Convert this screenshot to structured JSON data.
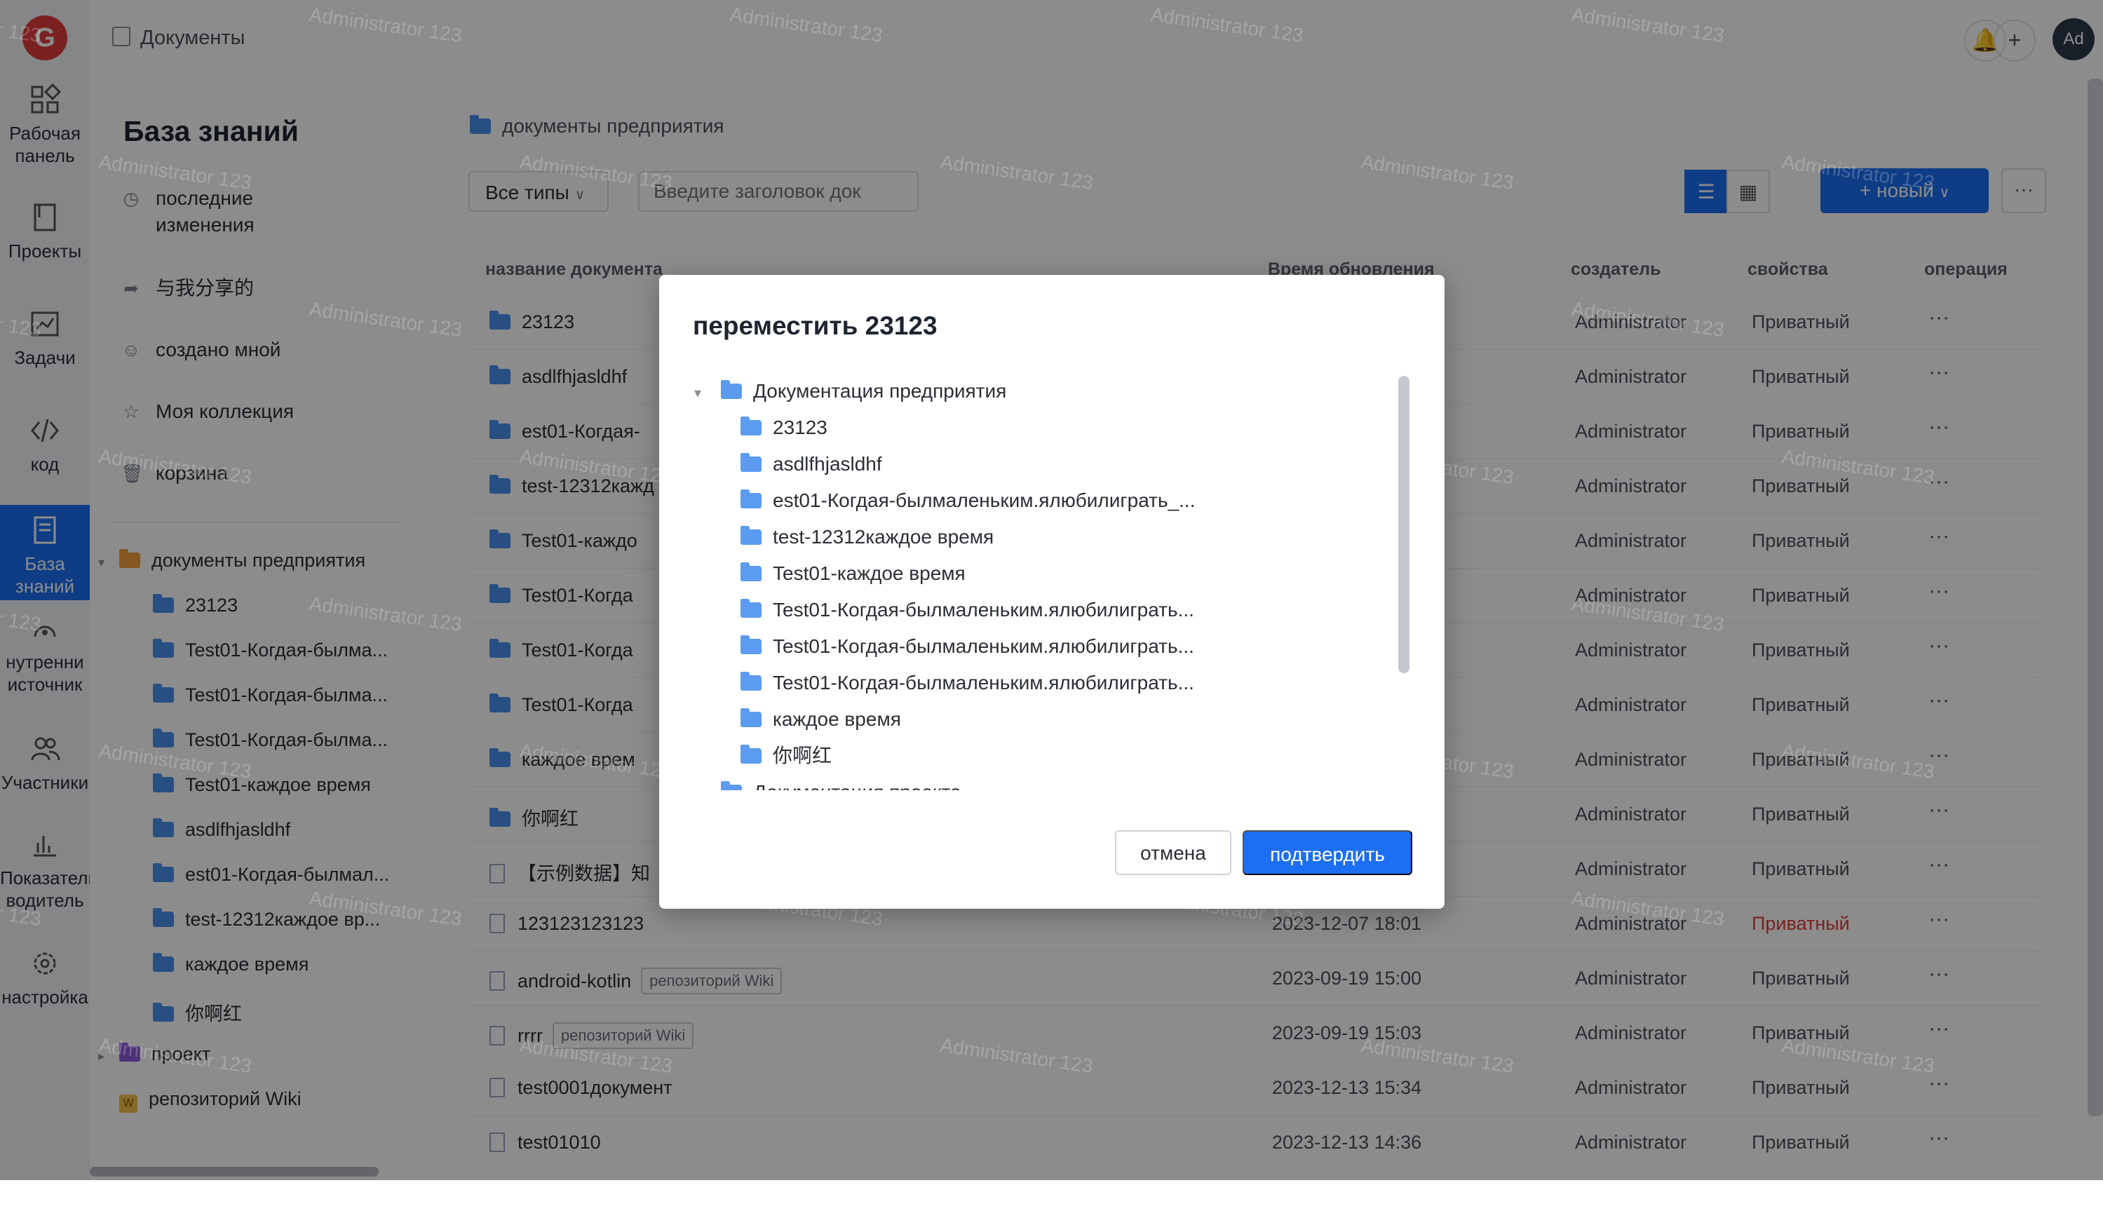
{
  "rail": {
    "logo": "G",
    "items": [
      {
        "label": "Рабочая панель",
        "icon": "dashboard-icon"
      },
      {
        "label": "Проекты",
        "icon": "book-icon"
      },
      {
        "label": "Задачи",
        "icon": "chart-board-icon"
      },
      {
        "label": "код",
        "icon": "code-icon"
      },
      {
        "label": "База знаний",
        "icon": "document-icon"
      },
      {
        "label": "нутренни источник",
        "icon": "source-icon"
      },
      {
        "label": "Участники",
        "icon": "users-icon"
      },
      {
        "label": "Показатели водитель",
        "icon": "stats-icon"
      },
      {
        "label": "настройка",
        "icon": "gear-icon"
      }
    ]
  },
  "topbar": {
    "breadcrumb": "Документы",
    "avatar": "Ad"
  },
  "kb": {
    "title": "База знаний",
    "nav": [
      {
        "label": "последние изменения",
        "icon": "clock-icon"
      },
      {
        "label": "与我分享的",
        "icon": "share-icon"
      },
      {
        "label": "создано мной",
        "icon": "person-icon"
      },
      {
        "label": "Моя коллекция",
        "icon": "star-icon"
      },
      {
        "label": "корзина",
        "icon": "trash-icon"
      }
    ],
    "tree": [
      {
        "label": "документы предприятия"
      },
      {
        "label": "23123"
      },
      {
        "label": "Test01-Когдая-былма..."
      },
      {
        "label": "Test01-Когдая-былма..."
      },
      {
        "label": "Test01-Когдая-былма..."
      },
      {
        "label": "Test01-каждое время"
      },
      {
        "label": "asdlfhjasldhf"
      },
      {
        "label": "est01-Когдая-былмал..."
      },
      {
        "label": "test-12312каждое вр..."
      },
      {
        "label": "каждое время"
      },
      {
        "label": "你啊红"
      },
      {
        "label": "проект"
      },
      {
        "label": "репозиторий Wiki"
      }
    ]
  },
  "main": {
    "path": "документы предприятия",
    "filter": "Все типы",
    "search_placeholder": "Введите заголовок док",
    "new_label": "+ новый",
    "columns": {
      "name": "название документа",
      "time": "Время обновления",
      "owner": "создатель",
      "prop": "свойства",
      "op": "операция"
    },
    "rows": [
      {
        "name": "23123",
        "type": "folder",
        "time": "",
        "owner": "Administrator",
        "prop": "Приватный"
      },
      {
        "name": "asdlfhjasldhf",
        "type": "folder",
        "time": "",
        "owner": "Administrator",
        "prop": "Приватный"
      },
      {
        "name": "est01-Когдая-",
        "type": "folder",
        "time": "",
        "owner": "Administrator",
        "prop": "Приватный"
      },
      {
        "name": "test-12312кажд",
        "type": "folder",
        "time": "",
        "owner": "Administrator",
        "prop": "Приватный"
      },
      {
        "name": "Test01-каждо",
        "type": "folder",
        "time": "",
        "owner": "Administrator",
        "prop": "Приватный"
      },
      {
        "name": "Test01-Когда",
        "type": "folder",
        "time": "",
        "owner": "Administrator",
        "prop": "Приватный"
      },
      {
        "name": "Test01-Когда",
        "type": "folder",
        "time": "",
        "owner": "Administrator",
        "prop": "Приватный"
      },
      {
        "name": "Test01-Когда",
        "type": "folder",
        "time": "",
        "owner": "Administrator",
        "prop": "Приватный"
      },
      {
        "name": "каждое врем",
        "type": "folder",
        "time": "",
        "owner": "Administrator",
        "prop": "Приватный"
      },
      {
        "name": "你啊红",
        "type": "folder",
        "time": "",
        "owner": "Administrator",
        "prop": "Приватный"
      },
      {
        "name": "【示例数据】知",
        "type": "doc",
        "time": "",
        "owner": "Administrator",
        "prop": "Приватный"
      },
      {
        "name": "123123123123",
        "type": "doc",
        "time": "2023-12-07 18:01",
        "owner": "Administrator",
        "prop": "Приватный",
        "red": true
      },
      {
        "name": "android-kotlin",
        "tag": "репозиторий Wiki",
        "type": "doc",
        "time": "2023-09-19 15:00",
        "owner": "Administrator",
        "prop": "Приватный"
      },
      {
        "name": "rrrr",
        "tag": "репозиторий Wiki",
        "type": "doc",
        "time": "2023-09-19 15:03",
        "owner": "Administrator",
        "prop": "Приватный"
      },
      {
        "name": "test0001документ",
        "type": "doc",
        "time": "2023-12-13 15:34",
        "owner": "Administrator",
        "prop": "Приватный"
      },
      {
        "name": "test01010",
        "type": "doc",
        "time": "2023-12-13 14:36",
        "owner": "Administrator",
        "prop": "Приватный"
      }
    ],
    "op_label": "···"
  },
  "modal": {
    "title": "переместить 23123",
    "tree": [
      {
        "label": "Документация предприятия",
        "level": 0,
        "open": true
      },
      {
        "label": "23123",
        "level": 1
      },
      {
        "label": "asdlfhjasldhf",
        "level": 1
      },
      {
        "label": "est01-Когдая-былмаленьким.ялюбилиграть_...",
        "level": 1
      },
      {
        "label": "test-12312каждое время",
        "level": 1
      },
      {
        "label": "Test01-каждое время",
        "level": 1
      },
      {
        "label": "Test01-Когдая-былмаленьким.ялюбилиграть...",
        "level": 1
      },
      {
        "label": "Test01-Когдая-былмаленьким.ялюбилиграть...",
        "level": 1
      },
      {
        "label": "Test01-Когдая-былмаленьким.ялюбилиграть...",
        "level": 1
      },
      {
        "label": "каждое время",
        "level": 1
      },
      {
        "label": "你啊红",
        "level": 1
      },
      {
        "label": "Документация проекта",
        "level": 0,
        "open": false
      }
    ],
    "cancel": "отмена",
    "confirm": "подтвердить"
  },
  "watermark": "Administrator 123",
  "colors": {
    "accent": "#1d6ff2",
    "danger": "#e03c3c"
  }
}
